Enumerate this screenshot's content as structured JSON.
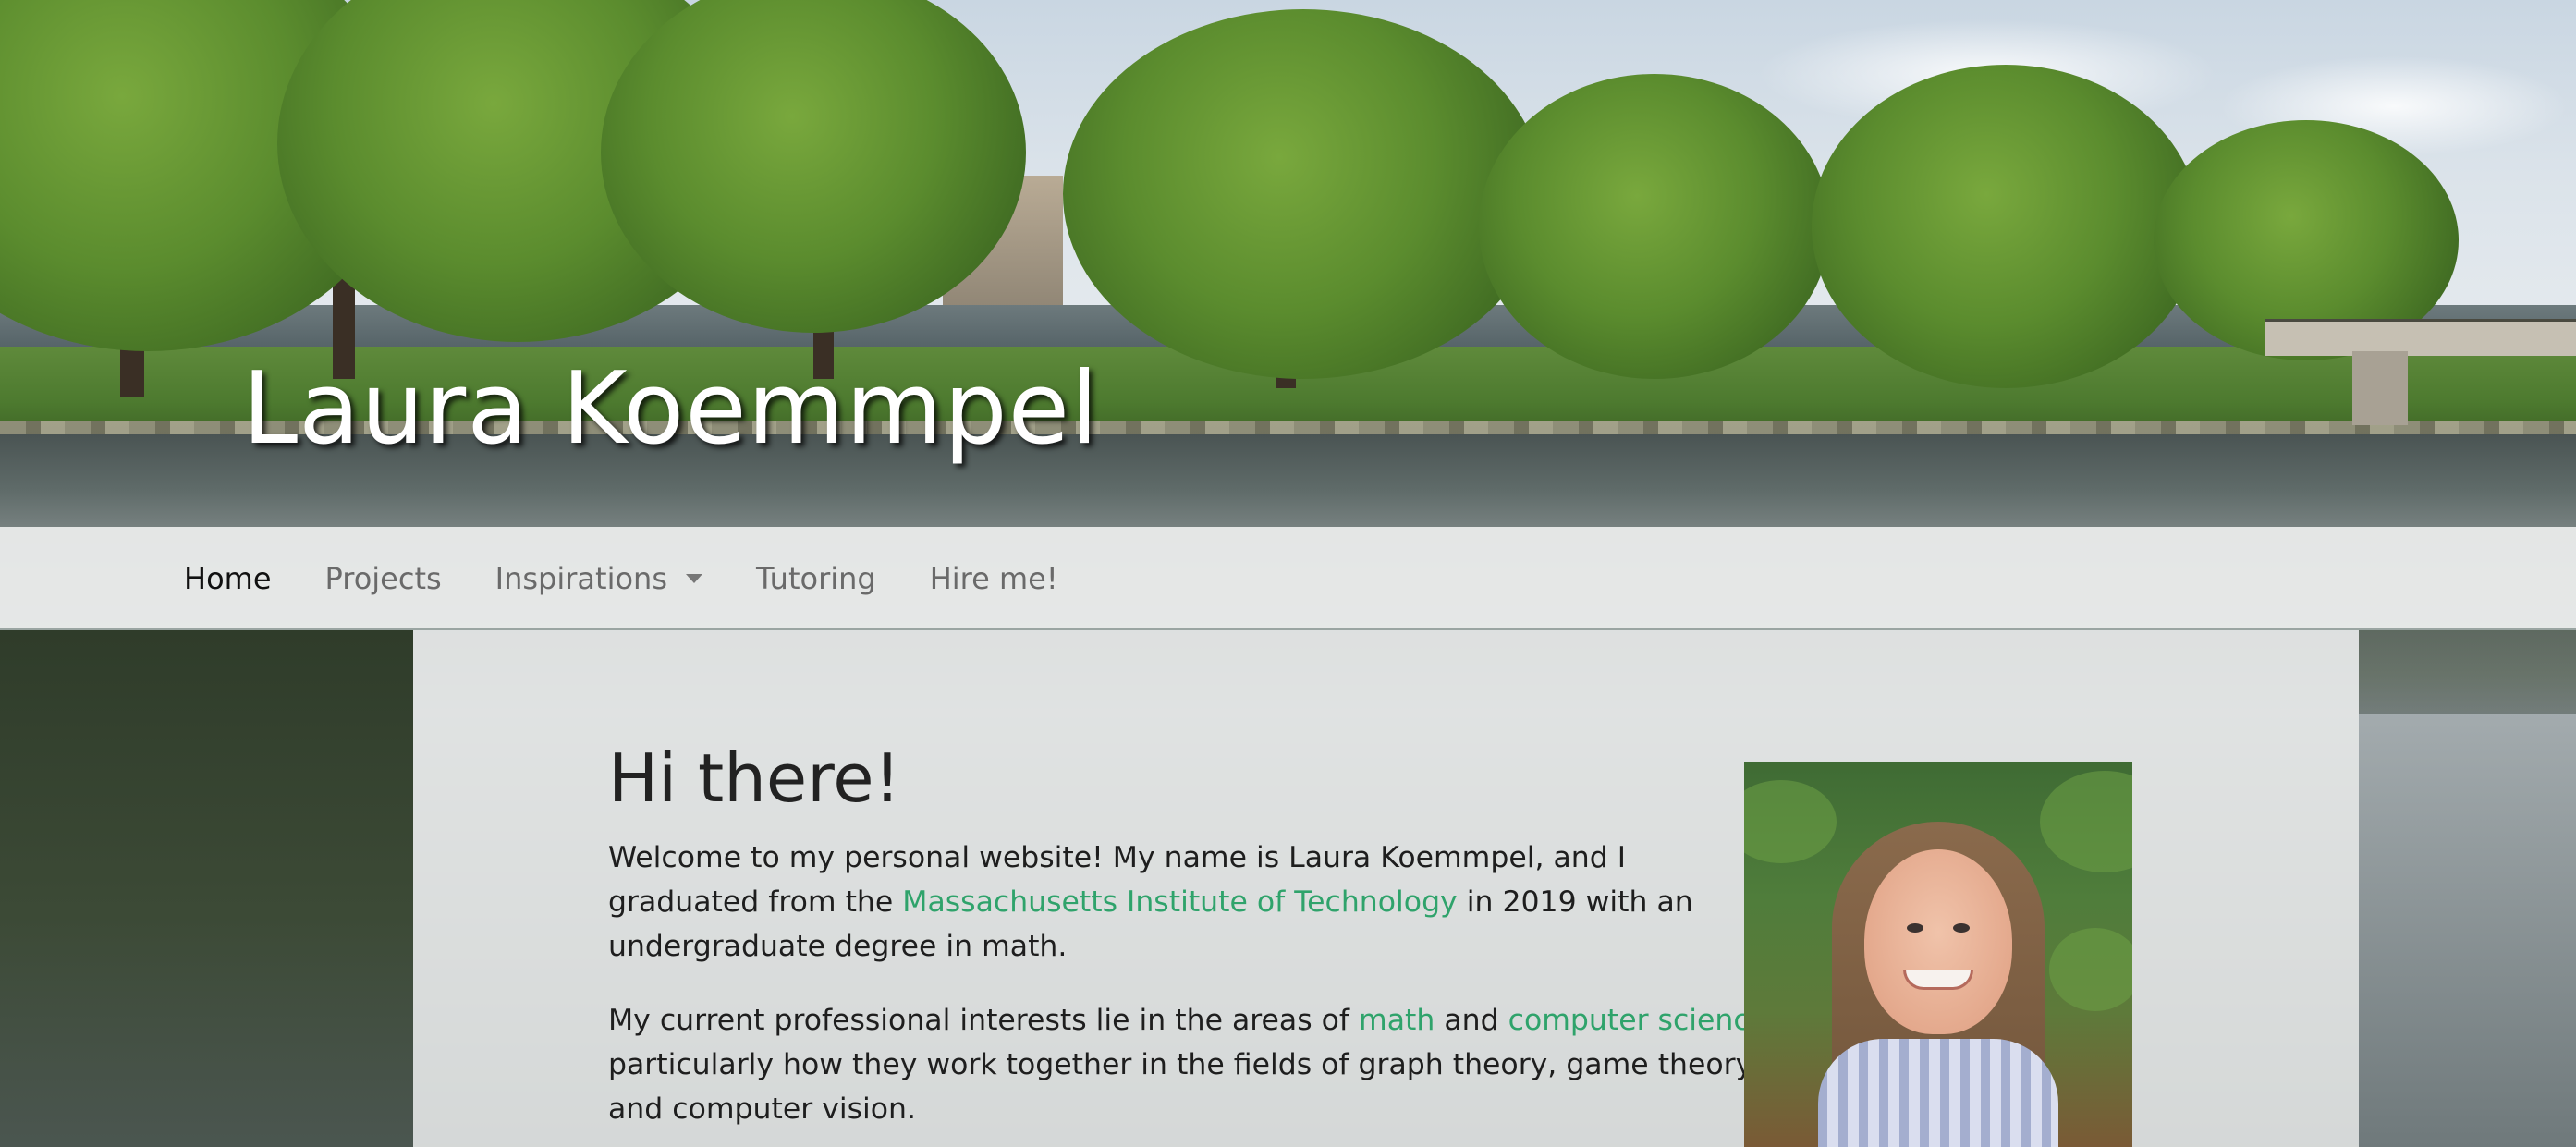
{
  "site": {
    "title": "Laura Koemmpel"
  },
  "nav": {
    "items": [
      {
        "label": "Home",
        "active": true
      },
      {
        "label": "Projects"
      },
      {
        "label": "Inspirations",
        "dropdown": true
      },
      {
        "label": "Tutoring"
      },
      {
        "label": "Hire me!"
      }
    ]
  },
  "main": {
    "heading": "Hi there!",
    "para1": {
      "before": "Welcome to my personal website! My name is Laura Koemmpel, and I graduated from the ",
      "link": "Massachusetts Institute of Technology",
      "after": " in 2019 with an undergraduate degree in math."
    },
    "para2": {
      "before": "My current professional interests lie in the areas of ",
      "link1": "math",
      "mid": " and ",
      "link2": "computer science",
      "after": ", particularly how they work together in the fields of graph theory, game theory, and computer vision."
    }
  },
  "colors": {
    "link": "#2fa36b",
    "nav_active": "#111111",
    "nav_inactive": "#6a6a6a"
  },
  "icons": {
    "dropdown": "caret-down-icon"
  }
}
